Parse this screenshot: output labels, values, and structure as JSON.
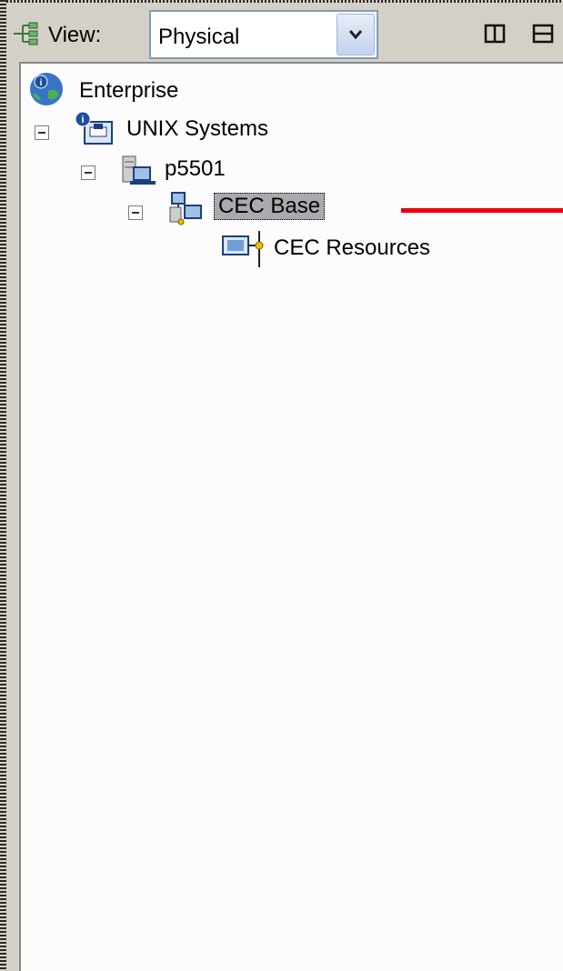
{
  "toolbar": {
    "view_label": "View:",
    "view_value": "Physical",
    "icons": [
      "network-view-icon",
      "columns-layout-icon",
      "rows-layout-icon"
    ]
  },
  "tree": {
    "enterprise": "Enterprise",
    "unix_systems": "UNIX Systems",
    "p5501": "p5501",
    "cec_base": "CEC Base",
    "cec_resources": "CEC Resources"
  },
  "colors": {
    "selection_bg": "#a9a9ae",
    "annotation_line": "#e8000b",
    "panel_bg": "#d4d0c8"
  }
}
